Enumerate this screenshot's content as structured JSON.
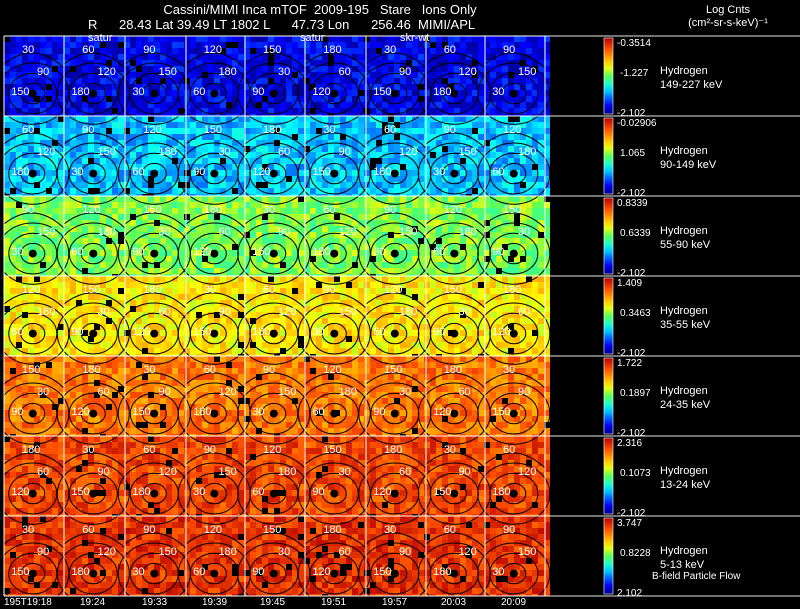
{
  "header": {
    "title": "Cassini/MIMI Inca mTOF  2009-195   Stare   Ions Only",
    "subtitle": "R      28.43 Lat 39.49 LT 1802 L      47.73 Lon      256.46  MIMI/APL"
  },
  "legend": {
    "title_line1": "Log Cnts",
    "title_line2": "(cm²-sr-s-keV)⁻¹"
  },
  "overlay_labels": [
    "satur",
    "satur",
    "skr-wt"
  ],
  "footnote": "B-field Particle Flow",
  "chart_data": {
    "type": "heatmap",
    "title": "Cassini/MIMI Inca mTOF  2009-195   Stare   Ions Only",
    "x_tick_labels": [
      "195T19:18",
      "19:24",
      "19:33",
      "19:39",
      "19:45",
      "19:51",
      "19:57",
      "20:03",
      "20:09"
    ],
    "contour_labels": [
      "30",
      "60",
      "90",
      "120",
      "150",
      "180"
    ],
    "colormap": "rainbow",
    "rows": [
      {
        "species": "Hydrogen",
        "energy": "149-227 keV",
        "cb_max": "-0.3514",
        "cb_mid": "-1.227",
        "cb_min": "-2.102",
        "level": 0.1
      },
      {
        "species": "Hydrogen",
        "energy": "90-149 keV",
        "cb_max": "-0.02906",
        "cb_mid": "1.065",
        "cb_min": "-2.102",
        "level": 0.3
      },
      {
        "species": "Hydrogen",
        "energy": "55-90 keV",
        "cb_max": "0.8339",
        "cb_mid": "0.6339",
        "cb_min": "-2.102",
        "level": 0.52
      },
      {
        "species": "Hydrogen",
        "energy": "35-55 keV",
        "cb_max": "1.409",
        "cb_mid": "0.3463",
        "cb_min": "-2.102",
        "level": 0.65
      },
      {
        "species": "Hydrogen",
        "energy": "24-35 keV",
        "cb_max": "1.722",
        "cb_mid": "0.1897",
        "cb_min": "-2.102",
        "level": 0.8
      },
      {
        "species": "Hydrogen",
        "energy": "13-24 keV",
        "cb_max": "2.316",
        "cb_mid": "0.1073",
        "cb_min": "-2.102",
        "level": 0.87
      },
      {
        "species": "Hydrogen",
        "energy": "5-13 keV",
        "cb_max": "3.747",
        "cb_mid": "0.8228",
        "cb_min": "2.102",
        "level": 0.9
      }
    ]
  }
}
